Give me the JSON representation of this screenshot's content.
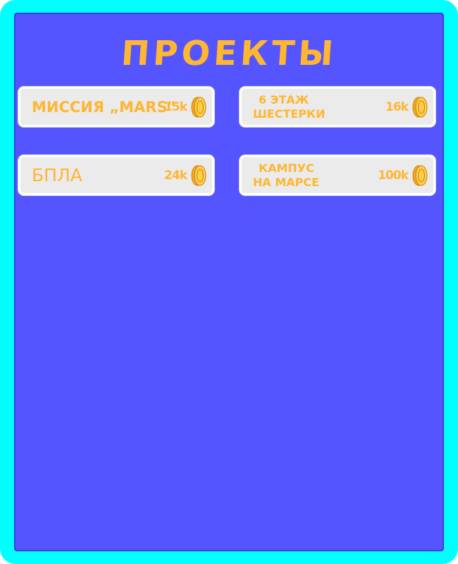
{
  "page": {
    "title": "ПРОЕКТЫ",
    "colors": {
      "frame": "#00ffff",
      "panel": "#5555ff",
      "card": "#ebebeb",
      "accent": "#ffb631"
    }
  },
  "projects": [
    {
      "name": "МИССИЯ „MARS\"",
      "price": "15k",
      "icon": "coin-icon"
    },
    {
      "name_line1": "6 ЭТАЖ",
      "name_line2": "ШЕСТЕРКИ",
      "price": "16k",
      "icon": "coin-icon"
    },
    {
      "name": "БПЛА",
      "price": "24k",
      "icon": "coin-icon"
    },
    {
      "name_line1": "КАМПУС",
      "name_line2": "НА МАРСЕ",
      "price": "100k",
      "icon": "coin-icon"
    }
  ]
}
